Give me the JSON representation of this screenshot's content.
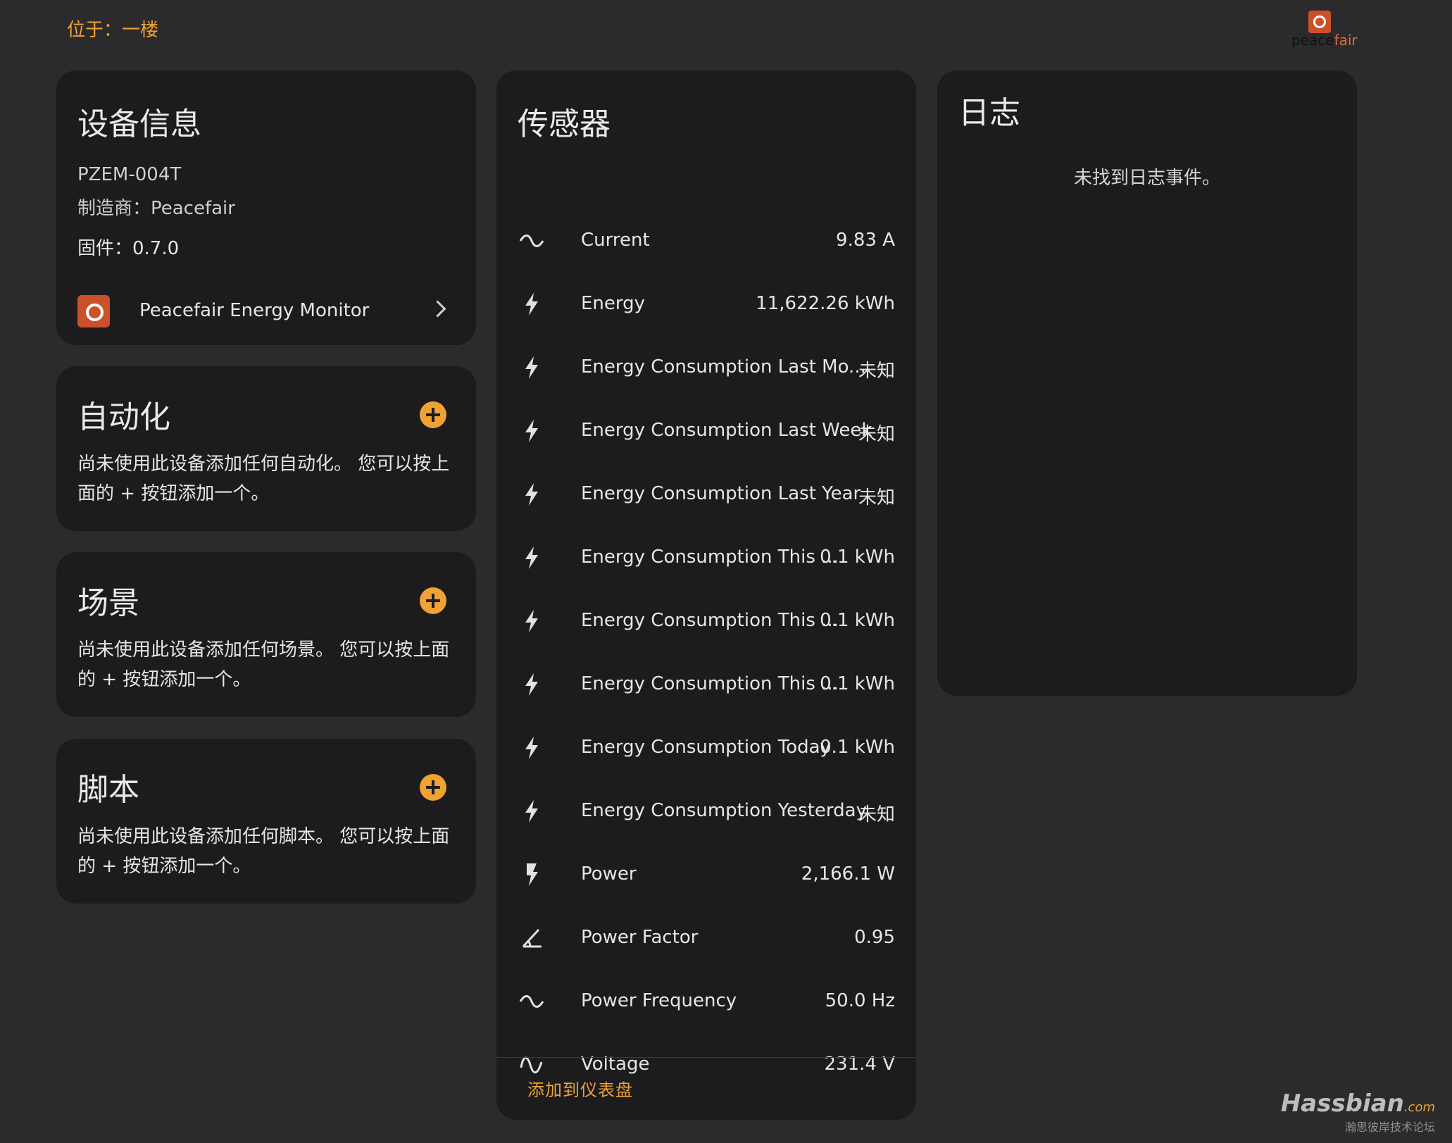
{
  "location": "位于：一楼",
  "brand": {
    "word_a": "peace",
    "word_b": "fair"
  },
  "device": {
    "title": "设备信息",
    "model": "PZEM-004T",
    "manufacturer": "制造商：Peacefair",
    "firmware": "固件：0.7.0",
    "link_label": "Peacefair Energy Monitor"
  },
  "automation": {
    "title": "自动化",
    "desc": "尚未使用此设备添加任何自动化。 您可以按上面的 + 按钮添加一个。"
  },
  "scenes": {
    "title": "场景",
    "desc": "尚未使用此设备添加任何场景。 您可以按上面的 + 按钮添加一个。"
  },
  "scripts": {
    "title": "脚本",
    "desc": "尚未使用此设备添加任何脚本。 您可以按上面的 + 按钮添加一个。"
  },
  "sensors": {
    "title": "传感器",
    "items": [
      {
        "name": "Current",
        "value": "9.83 A",
        "icon": "sine-wave-icon"
      },
      {
        "name": "Energy",
        "value": "11,622.26 kWh",
        "icon": "lightning-icon"
      },
      {
        "name": "Energy Consumption Last Mo...",
        "value": "未知",
        "icon": "lightning-icon"
      },
      {
        "name": "Energy Consumption Last Week",
        "value": "未知",
        "icon": "lightning-icon"
      },
      {
        "name": "Energy Consumption Last Year",
        "value": "未知",
        "icon": "lightning-icon"
      },
      {
        "name": "Energy Consumption This ...",
        "value": "0.1 kWh",
        "icon": "lightning-icon"
      },
      {
        "name": "Energy Consumption This ...",
        "value": "0.1 kWh",
        "icon": "lightning-icon"
      },
      {
        "name": "Energy Consumption This ...",
        "value": "0.1 kWh",
        "icon": "lightning-icon"
      },
      {
        "name": "Energy Consumption Today",
        "value": "0.1 kWh",
        "icon": "lightning-icon"
      },
      {
        "name": "Energy Consumption Yesterday",
        "value": "未知",
        "icon": "lightning-icon"
      },
      {
        "name": "Power",
        "value": "2,166.1 W",
        "icon": "flash-icon"
      },
      {
        "name": "Power Factor",
        "value": "0.95",
        "icon": "angle-icon"
      },
      {
        "name": "Power Frequency",
        "value": "50.0 Hz",
        "icon": "sine-wave-icon"
      },
      {
        "name": "Voltage",
        "value": "231.4 V",
        "icon": "voltage-wave-icon"
      }
    ],
    "add_to_dashboard": "添加到仪表盘"
  },
  "logbook": {
    "title": "日志",
    "empty": "未找到日志事件。"
  },
  "watermark": {
    "main": "Hassbian",
    "com": ".com",
    "sub": "瀚思彼岸技术论坛"
  },
  "colors": {
    "accent": "#f0a232",
    "card": "#1c1c1e",
    "background": "#2b2b2d"
  }
}
